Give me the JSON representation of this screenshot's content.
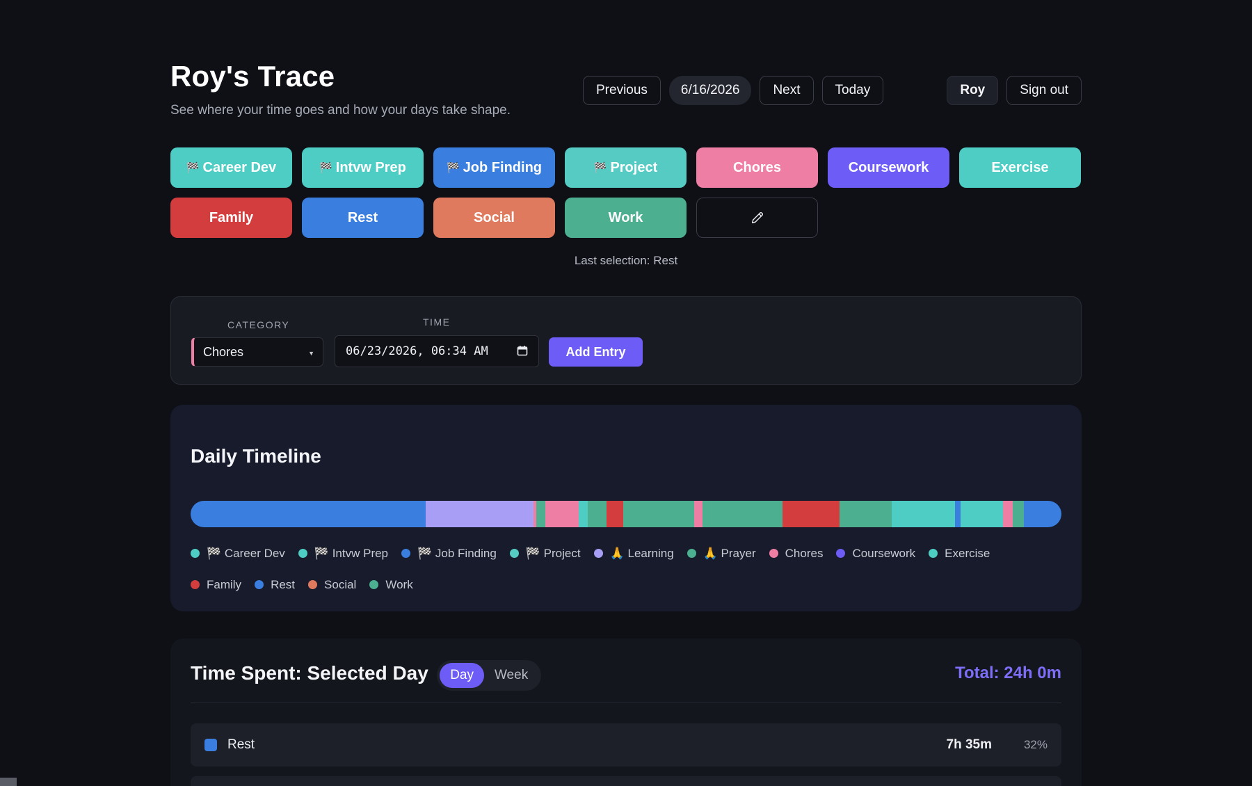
{
  "header": {
    "title": "Roy's Trace",
    "subtitle": "See where your time goes and how your days take shape.",
    "nav": {
      "previous": "Previous",
      "date": "6/16/2026",
      "next": "Next",
      "today": "Today"
    },
    "user": {
      "name": "Roy",
      "sign_out": "Sign out"
    }
  },
  "categories": [
    {
      "label": "Career Dev",
      "flag": "🏁",
      "color": "#4ecdc4"
    },
    {
      "label": "Intvw Prep",
      "flag": "🏁",
      "color": "#4ecdc4"
    },
    {
      "label": "Job Finding",
      "flag": "🏁",
      "color": "#3a7fe0"
    },
    {
      "label": "Project",
      "flag": "🏁",
      "color": "#56cbc3"
    },
    {
      "label": "Chores",
      "flag": "",
      "color": "#ef7ea5"
    },
    {
      "label": "Coursework",
      "flag": "",
      "color": "#6d5cf6"
    },
    {
      "label": "Exercise",
      "flag": "",
      "color": "#4ecdc4"
    },
    {
      "label": "Family",
      "flag": "",
      "color": "#d33d3d"
    },
    {
      "label": "Rest",
      "flag": "",
      "color": "#3a7fe0"
    },
    {
      "label": "Social",
      "flag": "",
      "color": "#e07a5f"
    },
    {
      "label": "Work",
      "flag": "",
      "color": "#4caf90"
    }
  ],
  "edit_icon": "pencil-icon",
  "last_selection": "Last selection: Rest",
  "entry": {
    "category_label": "CATEGORY",
    "time_label": "TIME",
    "category_value": "Chores",
    "time_value": "06/23/2026, 06:34 AM",
    "add_label": "Add Entry"
  },
  "timeline": {
    "title": "Daily Timeline",
    "segments": [
      {
        "category": "Rest",
        "share": 0.27,
        "color": "#3a7fe0"
      },
      {
        "category": "Learning",
        "share": 0.124,
        "color": "#a99ef5"
      },
      {
        "category": "Chores",
        "share": 0.003,
        "color": "#ef7ea5"
      },
      {
        "category": "Work",
        "share": 0.01,
        "color": "#4caf90"
      },
      {
        "category": "Chores",
        "share": 0.039,
        "color": "#ef7ea5"
      },
      {
        "category": "Exercise",
        "share": 0.01,
        "color": "#4ecdc4"
      },
      {
        "category": "Work",
        "share": 0.022,
        "color": "#4caf90"
      },
      {
        "category": "Family",
        "share": 0.019,
        "color": "#d33d3d"
      },
      {
        "category": "Work",
        "share": 0.081,
        "color": "#4caf90"
      },
      {
        "category": "Chores",
        "share": 0.01,
        "color": "#ef7ea5"
      },
      {
        "category": "Work",
        "share": 0.092,
        "color": "#4caf90"
      },
      {
        "category": "Family",
        "share": 0.065,
        "color": "#d33d3d"
      },
      {
        "category": "Work",
        "share": 0.06,
        "color": "#4caf90"
      },
      {
        "category": "Exercise",
        "share": 0.073,
        "color": "#4ecdc4"
      },
      {
        "category": "Rest",
        "share": 0.006,
        "color": "#3a7fe0"
      },
      {
        "category": "Exercise",
        "share": 0.049,
        "color": "#4ecdc4"
      },
      {
        "category": "Chores",
        "share": 0.011,
        "color": "#ef7ea5"
      },
      {
        "category": "Work",
        "share": 0.013,
        "color": "#4caf90"
      },
      {
        "category": "Rest",
        "share": 0.043,
        "color": "#3a7fe0"
      }
    ],
    "legend": [
      {
        "label": "🏁 Career Dev",
        "color": "#4ecdc4"
      },
      {
        "label": "🏁 Intvw Prep",
        "color": "#4ecdc4"
      },
      {
        "label": "🏁 Job Finding",
        "color": "#3a7fe0"
      },
      {
        "label": "🏁 Project",
        "color": "#56cbc3"
      },
      {
        "label": "🙏 Learning",
        "color": "#a99ef5"
      },
      {
        "label": "🙏 Prayer",
        "color": "#4caf90"
      },
      {
        "label": "Chores",
        "color": "#ef7ea5"
      },
      {
        "label": "Coursework",
        "color": "#6d5cf6"
      },
      {
        "label": "Exercise",
        "color": "#4ecdc4"
      },
      {
        "label": "Family",
        "color": "#d33d3d"
      },
      {
        "label": "Rest",
        "color": "#3a7fe0"
      },
      {
        "label": "Social",
        "color": "#e07a5f"
      },
      {
        "label": "Work",
        "color": "#4caf90"
      }
    ]
  },
  "time_spent": {
    "title": "Time Spent: Selected Day",
    "toggle": {
      "day": "Day",
      "week": "Week",
      "selected": "Day"
    },
    "total": "Total: 24h 0m",
    "rows": [
      {
        "category": "Rest",
        "duration": "7h 35m",
        "percent": "32%",
        "color": "#3a7fe0"
      }
    ]
  }
}
